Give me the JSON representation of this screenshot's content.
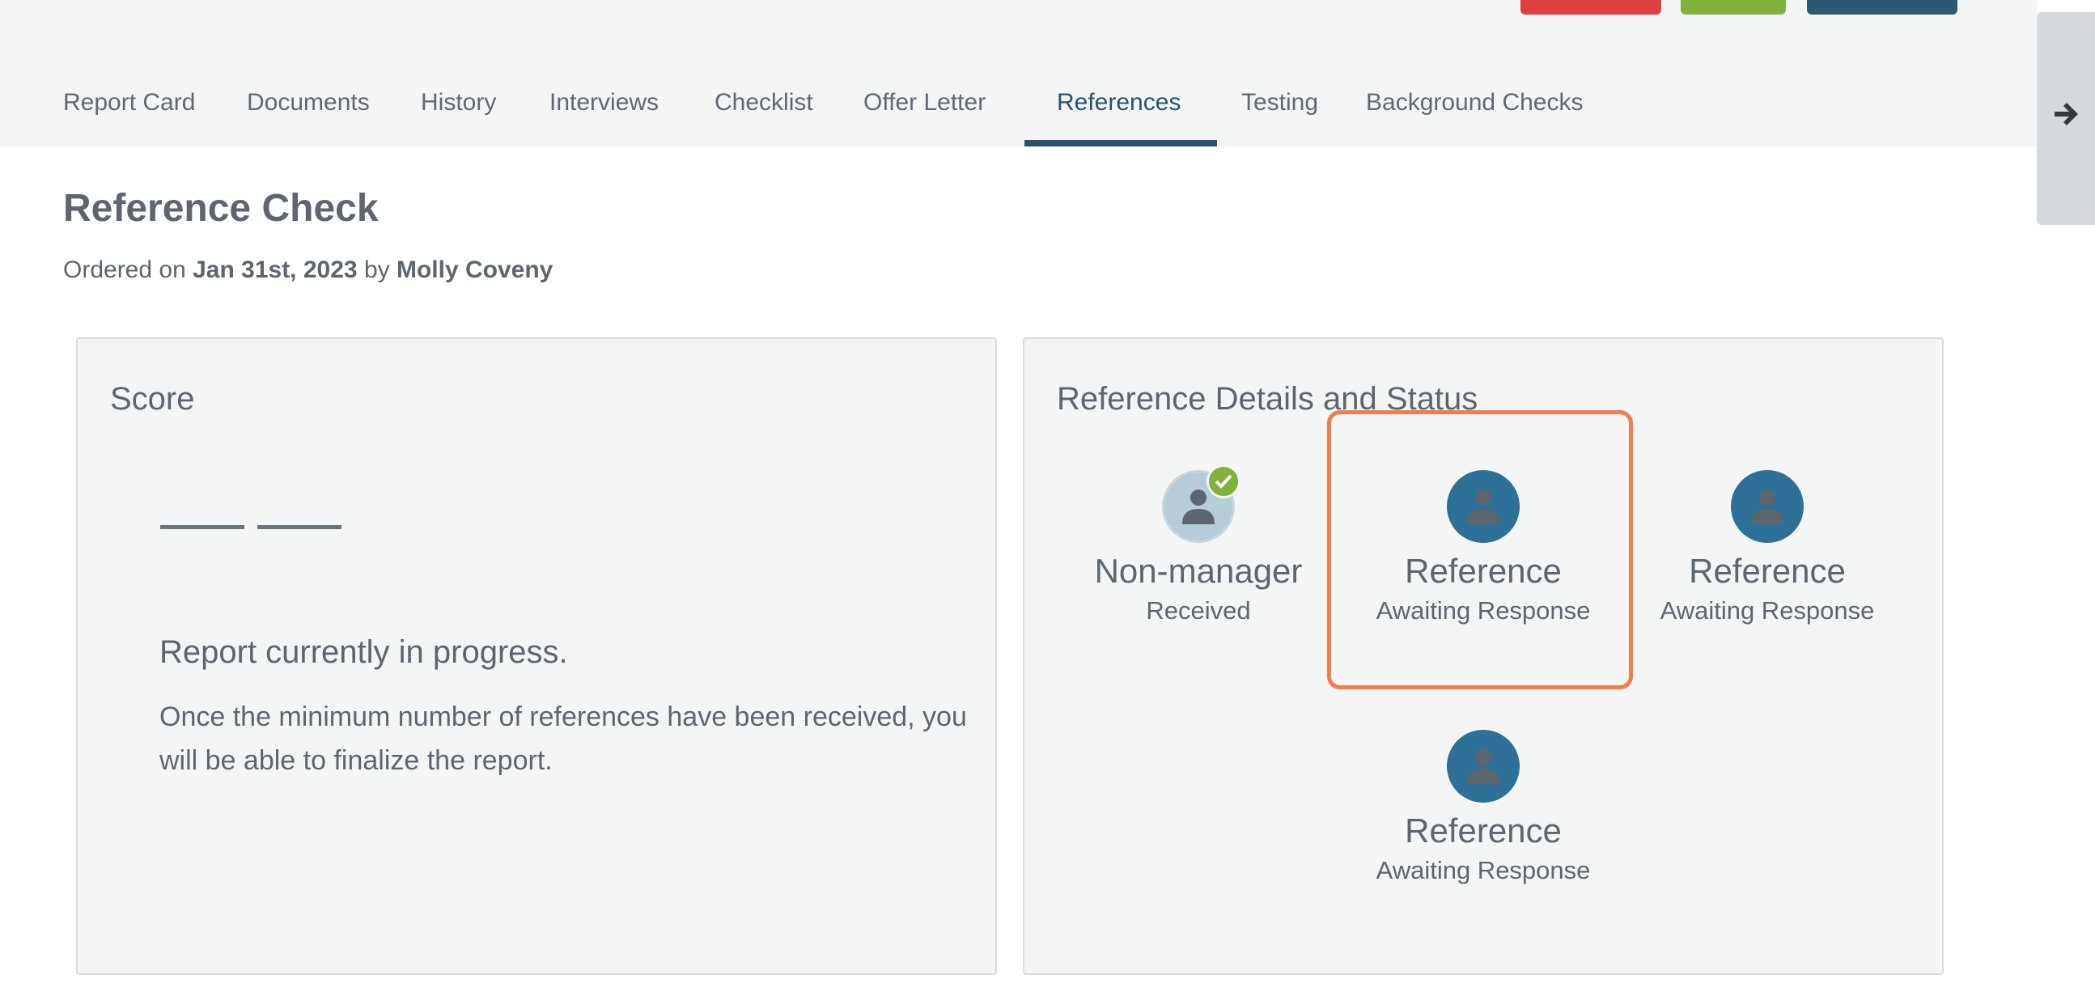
{
  "tabs": [
    {
      "label": "Report Card"
    },
    {
      "label": "Documents"
    },
    {
      "label": "History"
    },
    {
      "label": "Interviews"
    },
    {
      "label": "Checklist"
    },
    {
      "label": "Offer Letter"
    },
    {
      "label": "References",
      "active": true
    },
    {
      "label": "Testing"
    },
    {
      "label": "Background Checks"
    }
  ],
  "header": {
    "title": "Reference Check",
    "ordered_prefix": "Ordered on",
    "ordered_date": "Jan 31st, 2023",
    "ordered_by_word": "by",
    "ordered_by": "Molly Coveny"
  },
  "score_card": {
    "title": "Score",
    "progress_title": "Report currently in progress.",
    "progress_body": "Once the minimum number of references have been received, you will be able to finalize the report."
  },
  "details_card": {
    "title": "Reference Details and Status",
    "references": [
      {
        "name": "Non-manager",
        "status": "Received",
        "icon": "person-icon",
        "received": true
      },
      {
        "name": "Reference",
        "status": "Awaiting Response",
        "icon": "person-icon",
        "received": false
      },
      {
        "name": "Reference",
        "status": "Awaiting Response",
        "icon": "person-icon",
        "received": false
      },
      {
        "name": "Reference",
        "status": "Awaiting Response",
        "icon": "person-icon",
        "received": false
      }
    ]
  },
  "side_panel": {
    "icon": "arrow-right-icon"
  },
  "colors": {
    "accent": "#27546f",
    "received_badge": "#80b13a",
    "awaiting_avatar": "#2d7098",
    "highlight": "#f37c4d",
    "top_red": "#de4040",
    "top_green": "#80b13a",
    "top_blue": "#2d5873"
  }
}
